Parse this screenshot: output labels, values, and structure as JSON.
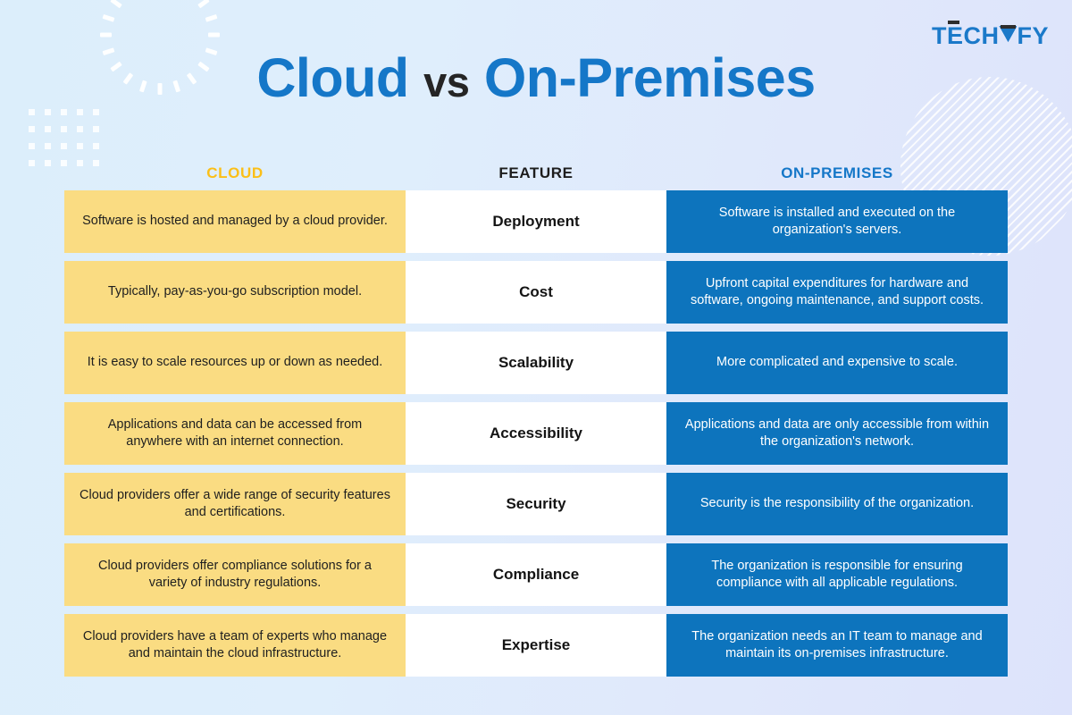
{
  "brand": {
    "name": "TECHVFY",
    "parts": [
      "T",
      "E",
      "CH",
      "V",
      "FY"
    ],
    "accent_color": "#1b79c9",
    "mark_color": "#2d2d2d"
  },
  "title": {
    "part1": "Cloud",
    "part2": "vs",
    "part3": "On-Premises",
    "part1_color": "#1577c8",
    "part2_color": "#252525",
    "part3_color": "#1577c8"
  },
  "colors": {
    "cloud_cell": "#fadc82",
    "onprem_cell": "#0d74bd",
    "feature_cell": "#ffffff",
    "cloud_header": "#fbbf18",
    "onprem_header": "#1577c8",
    "feature_header": "#1d1d1d",
    "background_left": "#dceefb",
    "background_right": "#dde3fb"
  },
  "decorations": [
    {
      "name": "radial-dashed-circle",
      "position": "top-left"
    },
    {
      "name": "dot-grid",
      "position": "left"
    },
    {
      "name": "diagonal-striped-circle",
      "position": "top-right"
    }
  ],
  "table": {
    "headers": {
      "cloud": "CLOUD",
      "feature": "FEATURE",
      "onpremises": "ON-PREMISES"
    },
    "rows": [
      {
        "feature": "Deployment",
        "cloud": "Software is hosted and managed by a cloud provider.",
        "onpremises": "Software is installed and executed on the organization's servers."
      },
      {
        "feature": "Cost",
        "cloud": "Typically, pay-as-you-go subscription model.",
        "onpremises": "Upfront capital expenditures for hardware and software, ongoing maintenance, and support costs."
      },
      {
        "feature": "Scalability",
        "cloud": "It is easy to scale resources up or down as needed.",
        "onpremises": "More complicated and expensive to scale."
      },
      {
        "feature": "Accessibility",
        "cloud": "Applications and data can be accessed from anywhere with an internet connection.",
        "onpremises": "Applications and data are only accessible from within the organization's network."
      },
      {
        "feature": "Security",
        "cloud": "Cloud providers offer a wide range of security features and certifications.",
        "onpremises": "Security is the responsibility of the organization."
      },
      {
        "feature": "Compliance",
        "cloud": "Cloud providers offer compliance solutions for a variety of industry regulations.",
        "onpremises": "The organization is responsible for ensuring compliance with all applicable regulations."
      },
      {
        "feature": "Expertise",
        "cloud": "Cloud providers have a team of experts who manage and maintain the cloud infrastructure.",
        "onpremises": "The organization needs an IT team to manage and maintain its on-premises infrastructure."
      }
    ]
  }
}
